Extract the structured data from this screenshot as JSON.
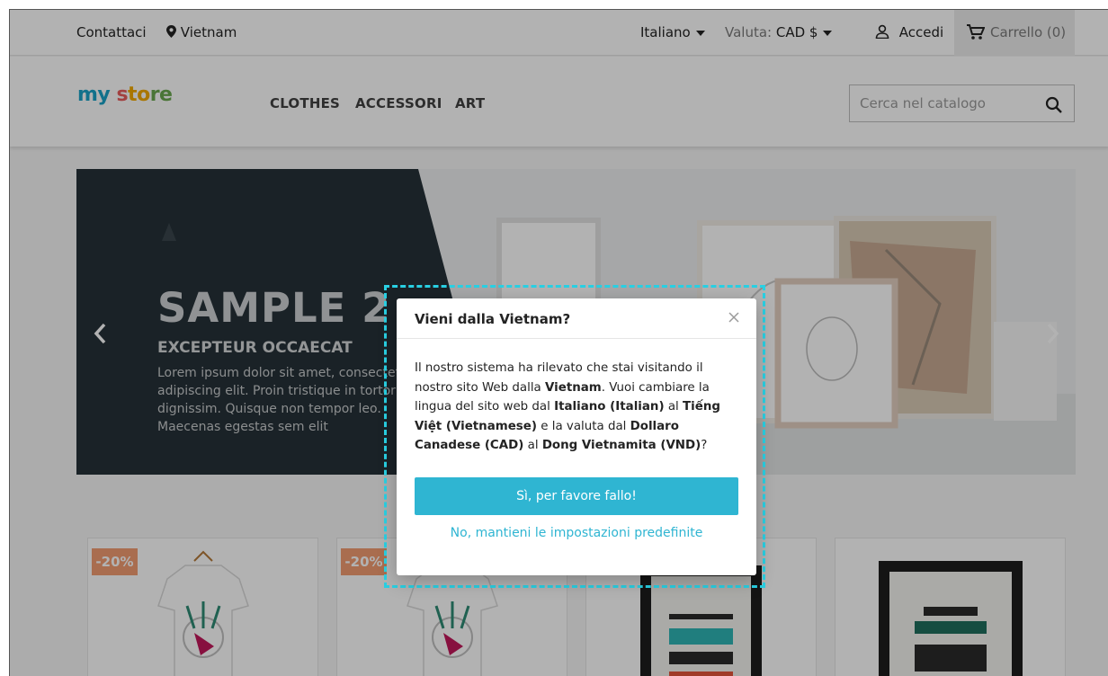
{
  "topnav": {
    "contact": "Contattaci",
    "location": "Vietnam",
    "language": "Italiano",
    "currency_label": "Valuta:",
    "currency_value": "CAD $",
    "signin": "Accedi",
    "cart": "Carrello (0)"
  },
  "header": {
    "logo": {
      "part1": "my",
      "part2": "s",
      "part3": "to",
      "part4": "re"
    },
    "menu": [
      "CLOTHES",
      "ACCESSORI",
      "ART"
    ],
    "search_placeholder": "Cerca nel catalogo"
  },
  "slider": {
    "title": "SAMPLE 2",
    "subtitle": "EXCEPTEUR OCCAECAT",
    "text": "Lorem ipsum dolor sit amet, consectetur adipiscing elit. Proin tristique in tortor et dignissim. Quisque non tempor leo. Maecenas egestas sem elit",
    "colors": {
      "dark_panel": "#263238"
    }
  },
  "products": {
    "badges": [
      "-20%",
      "-20%"
    ]
  },
  "modal": {
    "title": "Vieni dalla Vietnam?",
    "body": {
      "t1": "Il nostro sistema ha rilevato che stai visitando il nostro sito Web dalla ",
      "b1": "Vietnam",
      "t2": ". Vuoi cambiare la lingua del sito web dal ",
      "b2": "Italiano (Italian)",
      "t3": " al ",
      "b3": "Tiếng Việt (Vietnamese)",
      "t4": " e la valuta dal ",
      "b4": "Dollaro Canadese (CAD)",
      "t5": " al ",
      "b5": "Dong Vietnamita (VND)",
      "t6": "?"
    },
    "confirm_button": "Sì, per favore fallo!",
    "decline_link": "No, mantieni le impostazioni predefinite",
    "colors": {
      "accent": "#2fb5d2",
      "highlight": "#29d0e3"
    }
  },
  "icons": {
    "location": "map-marker-icon",
    "caret": "caret-down-icon",
    "user": "user-icon",
    "cart": "shopping-cart-icon",
    "search": "search-icon",
    "prev": "chevron-left-icon",
    "next": "chevron-right-icon",
    "close": "close-icon"
  }
}
